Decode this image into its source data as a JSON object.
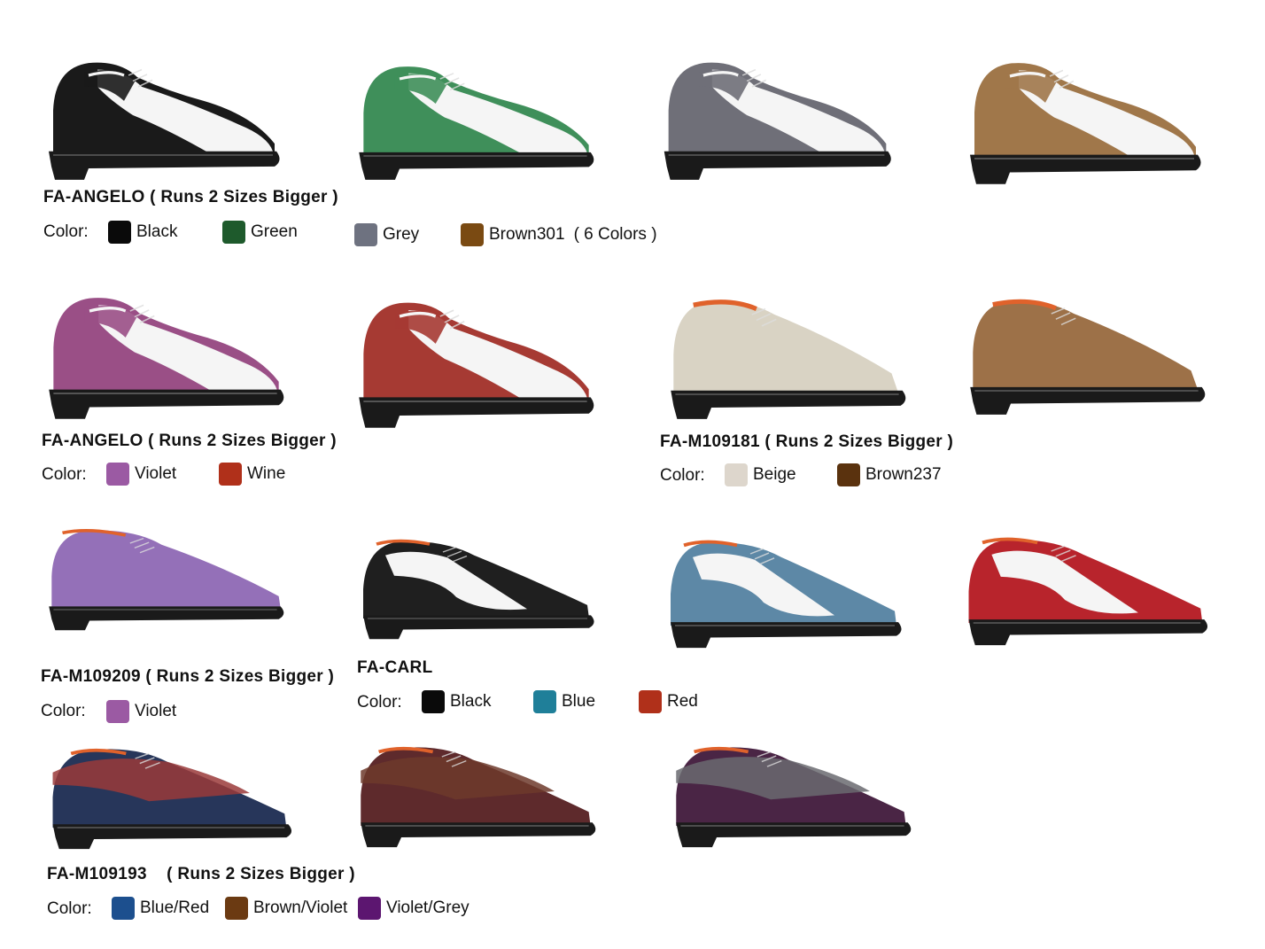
{
  "colors": {
    "black": "#0a0a0a",
    "green": "#1e5a2c",
    "grey": "#6e7280",
    "brown301": "#7a4a12",
    "violet": "#9b5aa3",
    "wine": "#b0301a",
    "beige": "#ddd6cc",
    "brown237": "#5a320e",
    "blue": "#1f7f99",
    "red": "#b0301a",
    "blue_red": "#1c4f8e",
    "brown_violet": "#6b3a12",
    "violet_grey": "#5c1670"
  },
  "sections": [
    {
      "title": "FA-ANGELO  ( Runs 2 Sizes Bigger )",
      "color_label": "Color:",
      "colors": [
        "Black",
        "Green",
        "Grey",
        "Brown301"
      ],
      "note": "( 6 Colors )"
    },
    {
      "title": "FA-ANGELO  ( Runs 2 Sizes Bigger )",
      "color_label": "Color:",
      "colors": [
        "Violet",
        "Wine"
      ]
    },
    {
      "title": "FA-M109181 ( Runs 2 Sizes Bigger )",
      "color_label": "Color:",
      "colors": [
        "Beige",
        "Brown237"
      ]
    },
    {
      "title": "FA-M109209 ( Runs 2 Sizes Bigger )",
      "color_label": "Color:",
      "colors": [
        "Violet"
      ]
    },
    {
      "title": "FA-CARL",
      "color_label": "Color:",
      "colors": [
        "Black",
        "Blue",
        "Red"
      ]
    },
    {
      "title": "FA-M109193    ( Runs 2 Sizes Bigger )",
      "color_label": "Color:",
      "colors": [
        "Blue/Red",
        "Brown/Violet",
        "Violet/Grey"
      ]
    }
  ],
  "shoes": [
    {
      "name": "angelo-black",
      "primary": "#1a1a1a",
      "secondary": "#f5f5f5",
      "style": "spectator"
    },
    {
      "name": "angelo-green",
      "primary": "#3f8f5a",
      "secondary": "#f5f5f5",
      "style": "spectator"
    },
    {
      "name": "angelo-grey",
      "primary": "#6f6f78",
      "secondary": "#f5f5f5",
      "style": "spectator"
    },
    {
      "name": "angelo-brown",
      "primary": "#a0774a",
      "secondary": "#f5f5f5",
      "style": "spectator"
    },
    {
      "name": "angelo-violet",
      "primary": "#9a4f86",
      "secondary": "#f5f5f5",
      "style": "spectator"
    },
    {
      "name": "angelo-wine",
      "primary": "#a63a33",
      "secondary": "#f5f5f5",
      "style": "spectator"
    },
    {
      "name": "m109181-beige",
      "primary": "#d9d3c4",
      "secondary": "#d9d3c4",
      "style": "oxford"
    },
    {
      "name": "m109181-brown",
      "primary": "#9d7148",
      "secondary": "#9d7148",
      "style": "oxford"
    },
    {
      "name": "m109209-violet",
      "primary": "#9470b8",
      "secondary": "#9470b8",
      "style": "croc"
    },
    {
      "name": "carl-black",
      "primary": "#1f1f1f",
      "secondary": "#f5f5f5",
      "style": "wingtip"
    },
    {
      "name": "carl-blue",
      "primary": "#5d88a6",
      "secondary": "#f5f5f5",
      "style": "wingtip"
    },
    {
      "name": "carl-red",
      "primary": "#b8242c",
      "secondary": "#f5f5f5",
      "style": "wingtip"
    },
    {
      "name": "m109193-blue-red",
      "primary": "#27365a",
      "secondary": "#9a3a3a",
      "style": "two-tone"
    },
    {
      "name": "m109193-brown-violet",
      "primary": "#5e2a2c",
      "secondary": "#6d3a2c",
      "style": "two-tone"
    },
    {
      "name": "m109193-violet-grey",
      "primary": "#4a2545",
      "secondary": "#6a6a70",
      "style": "two-tone"
    }
  ]
}
